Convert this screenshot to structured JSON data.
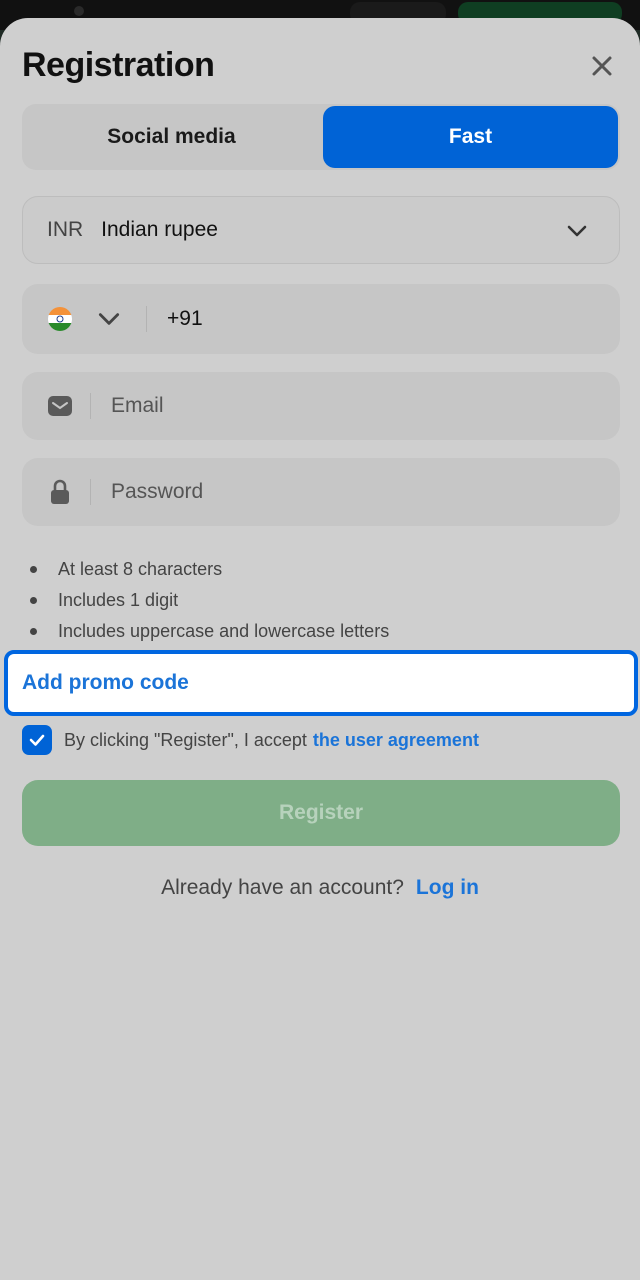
{
  "header": {
    "title": "Registration",
    "close_icon": "close-icon"
  },
  "tabs": [
    {
      "label": "Social media",
      "active": false
    },
    {
      "label": "Fast",
      "active": true
    }
  ],
  "currency": {
    "code": "INR",
    "name": "Indian rupee",
    "icon": "chevron-down-icon"
  },
  "phone": {
    "flag": "india-flag-icon",
    "country_code": "+91"
  },
  "email": {
    "placeholder": "Email",
    "value": "",
    "icon": "mail-icon"
  },
  "password": {
    "placeholder": "Password",
    "value": "",
    "icon": "lock-icon"
  },
  "password_rules": [
    "At least 8 characters",
    "Includes 1 digit",
    "Includes uppercase and lowercase letters"
  ],
  "promo": {
    "label": "Add promo code"
  },
  "agreement": {
    "checked": true,
    "text": "By clicking \"Register\", I accept",
    "link": "the user agreement"
  },
  "register": {
    "label": "Register",
    "enabled": false
  },
  "login": {
    "question": "Already have an account?",
    "link": "Log in"
  },
  "colors": {
    "accent": "#0063d6",
    "link": "#1b74d8",
    "register_disabled": "#7fae87",
    "sheet_bg": "#cfcfcf"
  }
}
